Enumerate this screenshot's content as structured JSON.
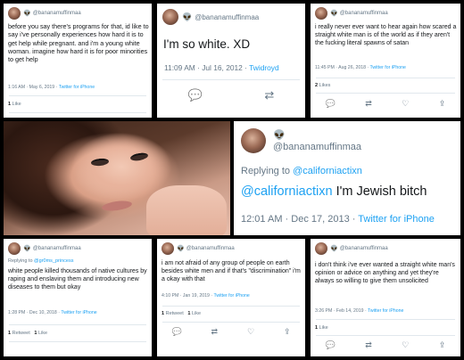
{
  "tweets": [
    {
      "handle": "@bananamuffinmaa",
      "text": "before you say there's programs for that, id like to say i've personally experiences how hard it is to get help while pregnant. and i'm a young white woman. imagine how hard it is for poor minorities to get help",
      "time": "1:16 AM · May 6, 2019 · ",
      "source": "Twitter for iPhone",
      "likes_count": "1",
      "likes_label": " Like"
    },
    {
      "handle": "@bananamuffinmaa",
      "text": "I'm so white. XD",
      "time": "11:09 AM · Jul 16, 2012 · ",
      "source": "Twidroyd"
    },
    {
      "handle": "@bananamuffinmaa",
      "text": "i really never ever want to hear again how scared a straight white man is of the world as if they aren't the fucking literal spawns of satan",
      "time": "11:45 PM · Aug 26, 2018 · ",
      "source": "Twitter for iPhone",
      "likes_count": "2",
      "likes_label": " Likes"
    },
    {
      "handle": "@bananamuffinmaa",
      "reply_prefix": "Replying to ",
      "reply_to": "@californiactixn",
      "mention": "@californiactixn",
      "text": " I'm Jewish bitch",
      "time": "12:01 AM · Dec 17, 2013 · ",
      "source": "Twitter for iPhone"
    },
    {
      "handle": "@bananamuffinmaa",
      "reply_prefix": "Replying to ",
      "reply_to": "@gr0ms_princess",
      "text": "white people killed thousands of native cultures by raping and enslaving them and introducing new diseases to them but okay",
      "time": "1:28 PM · Dec 10, 2018 · ",
      "source": "Twitter for iPhone",
      "retweets_count": "1",
      "retweets_label": " Retweet",
      "likes_count": "1",
      "likes_label": " Like"
    },
    {
      "handle": "@bananamuffinmaa",
      "text": "i am not afraid of any group of people on earth besides white men and if that's \"discrimination\" i'm a okay with that",
      "time": "4:10 PM · Jan 19, 2019 · ",
      "source": "Twitter for iPhone",
      "retweets_count": "1",
      "retweets_label": " Retweet",
      "likes_count": "1",
      "likes_label": " Like"
    },
    {
      "handle": "@bananamuffinmaa",
      "text": "i don't think i've ever wanted a straight white man's opinion or advice on anything and yet they're always so willing to give them unsolicited",
      "time": "3:26 PM · Feb 14, 2019 · ",
      "source": "Twitter for iPhone",
      "likes_count": "1",
      "likes_label": " Like"
    }
  ],
  "icons": {
    "alien": "👽",
    "reply": "💬",
    "retweet": "⇄",
    "like": "♡",
    "share": "⇪"
  },
  "colors": {
    "link": "#1da1f2",
    "muted": "#657786",
    "text": "#14171a"
  }
}
